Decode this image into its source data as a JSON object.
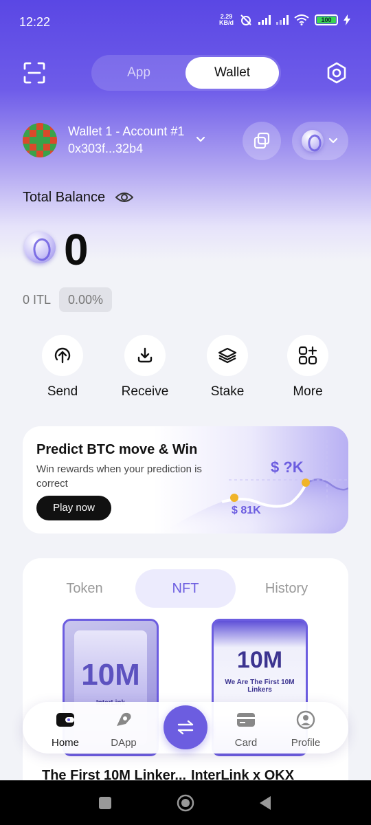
{
  "status_bar": {
    "time": "12:22",
    "net_speed_value": "2.29",
    "net_speed_unit": "KB/d",
    "battery": "100"
  },
  "header": {
    "segment_app": "App",
    "segment_wallet": "Wallet",
    "active_segment": "Wallet"
  },
  "account": {
    "name": "Wallet 1 - Account #1",
    "address": "0x303f...32b4"
  },
  "balance": {
    "label": "Total Balance",
    "value": "0",
    "token_amount": "0 ITL",
    "change": "0.00%"
  },
  "actions": [
    {
      "label": "Send",
      "icon": "arrow-up-circle-icon"
    },
    {
      "label": "Receive",
      "icon": "download-icon"
    },
    {
      "label": "Stake",
      "icon": "layers-icon"
    },
    {
      "label": "More",
      "icon": "grid-plus-icon"
    }
  ],
  "banner": {
    "title": "Predict BTC move & Win",
    "subtitle": "Win rewards when your prediction is correct",
    "button": "Play now",
    "target_label": "$ ?K",
    "current_label": "$ 81K"
  },
  "assets": {
    "tabs": [
      "Token",
      "NFT",
      "History"
    ],
    "active_tab": "NFT",
    "nfts": [
      {
        "name": "The First 10M Linker...",
        "art_big": "10M",
        "art_small": "InterLink"
      },
      {
        "name": "InterLink x OKX",
        "art_big": "10M",
        "art_small": "We Are The First 10M Linkers"
      }
    ]
  },
  "bottom_nav": {
    "items": [
      {
        "label": "Home",
        "icon": "wallet-icon",
        "active": true
      },
      {
        "label": "DApp",
        "icon": "compass-icon",
        "active": false
      },
      {
        "label": "Card",
        "icon": "card-icon",
        "active": false
      },
      {
        "label": "Profile",
        "icon": "profile-icon",
        "active": false
      }
    ],
    "center_icon": "swap-icon"
  },
  "colors": {
    "accent": "#6c5de0",
    "hero_top": "#5a47e4",
    "background": "#f2f3f8"
  }
}
